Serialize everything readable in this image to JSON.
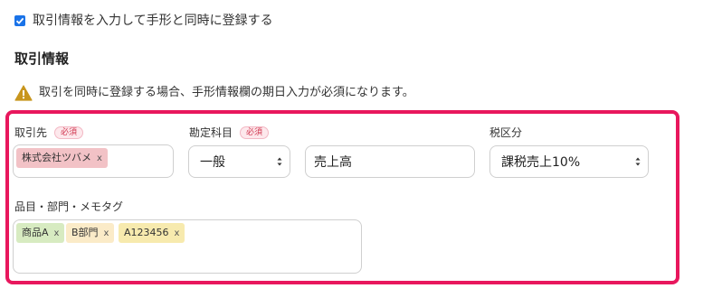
{
  "register_checkbox": {
    "checked": true,
    "label": "取引情報を入力して手形と同時に登録する"
  },
  "section": {
    "title": "取引情報"
  },
  "warning": {
    "icon": "warning-triangle-icon",
    "color": "#c8961e",
    "text": "取引を同時に登録する場合、手形情報欄の期日入力が必須になります。"
  },
  "highlight_color": "#e8175d",
  "fields": {
    "partner": {
      "label": "取引先",
      "required_badge": "必須",
      "tags": [
        {
          "text": "株式会社ツバメ",
          "remove": "x"
        }
      ]
    },
    "account": {
      "label": "勘定科目",
      "required_badge": "必須",
      "select_value": "一般",
      "input_value": "売上高"
    },
    "tax": {
      "label": "税区分",
      "select_value": "課税売上10%"
    },
    "memo_tags": {
      "label": "品目・部門・メモタグ",
      "tags": [
        {
          "text": "商品A",
          "remove": "x"
        },
        {
          "text": "B部門",
          "remove": "x"
        },
        {
          "text": "A123456",
          "remove": "x"
        }
      ]
    }
  }
}
